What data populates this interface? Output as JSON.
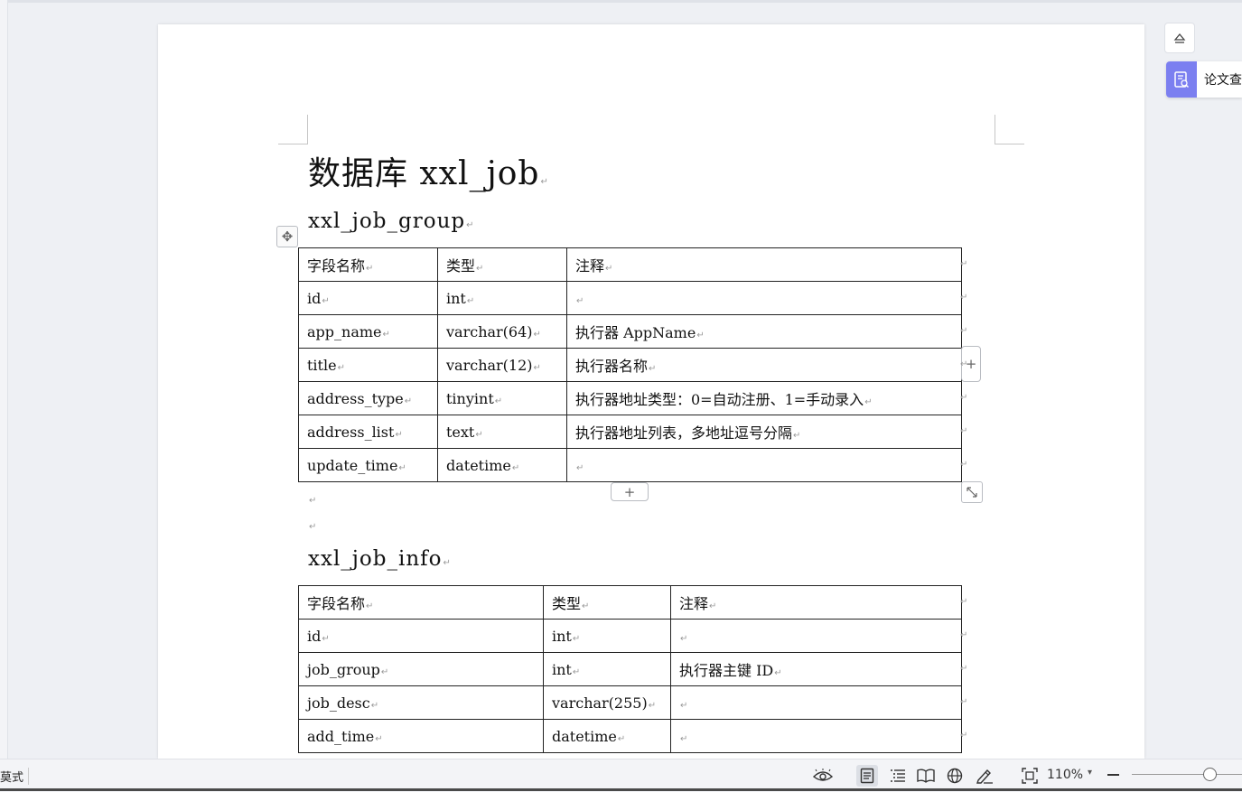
{
  "doc": {
    "title": "数据库 xxl_job",
    "para_mark": "↵",
    "section1": {
      "heading": "xxl_job_group",
      "columns": [
        "字段名称",
        "类型",
        "注释"
      ],
      "rows": [
        [
          "id",
          "int",
          ""
        ],
        [
          "app_name",
          "varchar(64)",
          "执行器 AppName"
        ],
        [
          "title",
          "varchar(12)",
          "执行器名称"
        ],
        [
          "address_type",
          "tinyint",
          "执行器地址类型：0=自动注册、1=手动录入"
        ],
        [
          "address_list",
          "text",
          "执行器地址列表，多地址逗号分隔"
        ],
        [
          "update_time",
          "datetime",
          ""
        ]
      ]
    },
    "section2": {
      "heading": "xxl_job_info",
      "columns": [
        "字段名称",
        "类型",
        "注释"
      ],
      "rows": [
        [
          "id",
          "int",
          ""
        ],
        [
          "job_group",
          "int",
          "执行器主键 ID"
        ],
        [
          "job_desc",
          "varchar(255)",
          ""
        ],
        [
          "add_time",
          "datetime",
          ""
        ]
      ]
    }
  },
  "table_tools": {
    "add_symbol": "+",
    "move_icon": "move-icon",
    "resize_icon": "resize-icon"
  },
  "sidebar": {
    "collapse_icon": "eject-icon",
    "paper_check_label": "论文查"
  },
  "statusbar": {
    "mode_label": "莫式",
    "zoom_label": "110%",
    "zoom_dropdown": "▾",
    "icons": [
      "eye-protection-icon",
      "page-view-icon",
      "outline-view-icon",
      "reading-mode-icon",
      "web-layout-icon",
      "pen-annotate-icon",
      "fit-page-icon"
    ],
    "accent": "#7b7ff0"
  }
}
